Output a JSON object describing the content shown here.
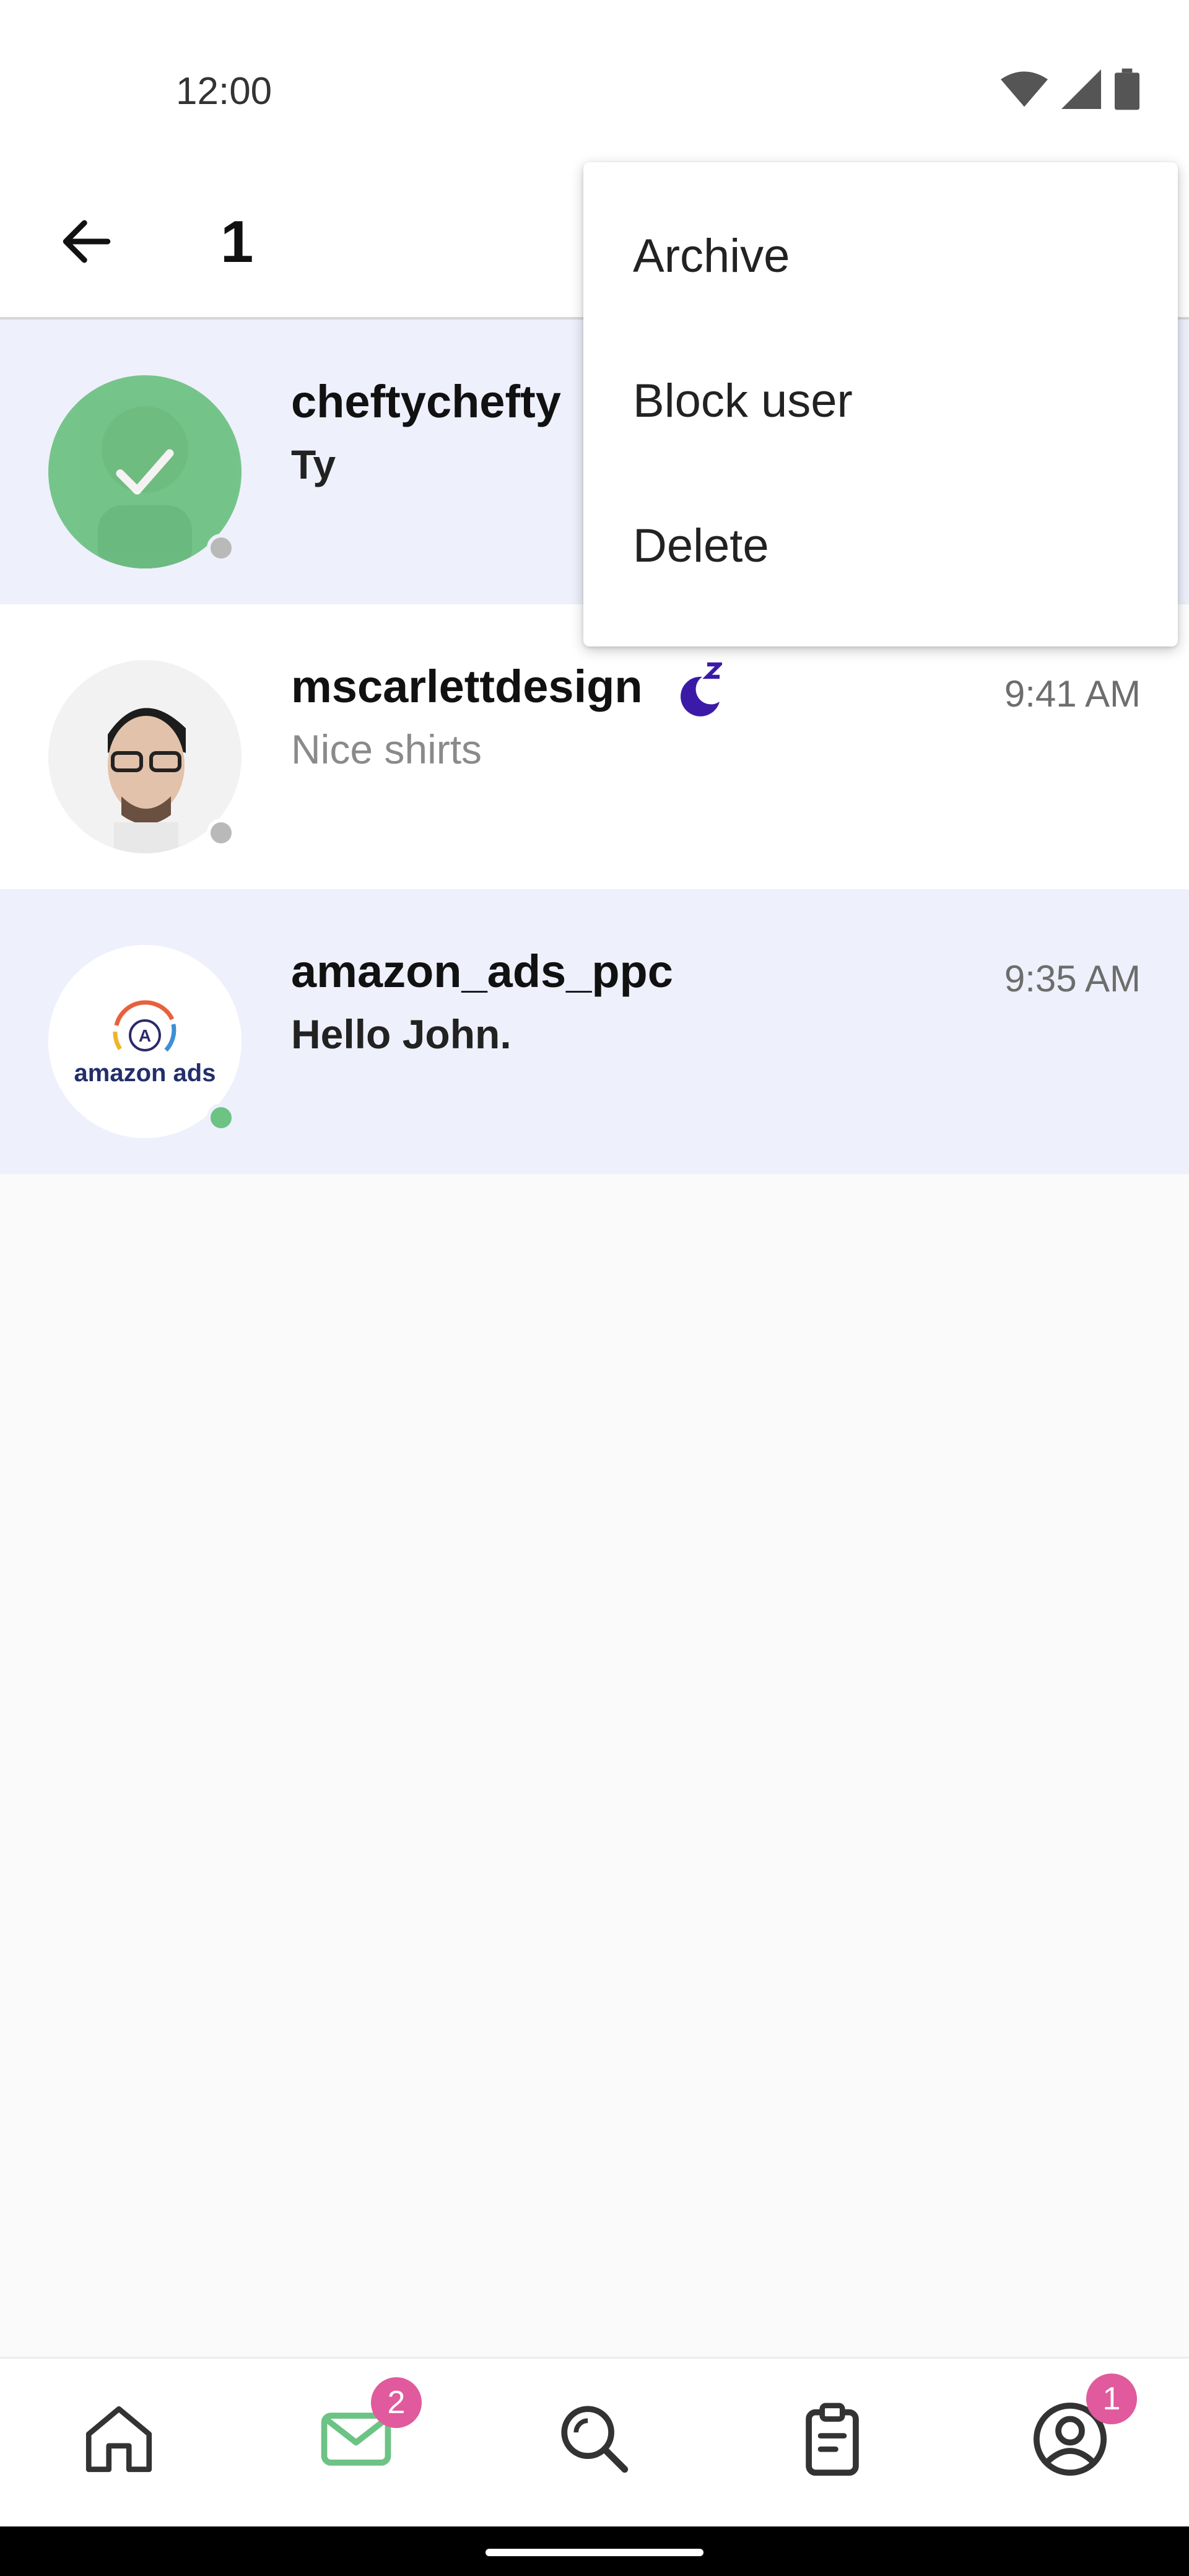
{
  "status_bar": {
    "time": "12:00",
    "icons": [
      "wifi-icon",
      "cell-signal-icon",
      "battery-icon"
    ]
  },
  "app_bar": {
    "back_icon": "arrow-left-icon",
    "selected_count": "1"
  },
  "menu": {
    "items": [
      "Archive",
      "Block user",
      "Delete"
    ]
  },
  "conversations": [
    {
      "name": "cheftychefty",
      "message": "Ty",
      "time": "",
      "state": "selected",
      "message_weight": "bold",
      "online": false
    },
    {
      "name": "mscarlettdesign",
      "message": "Nice shirts",
      "time": "9:41 AM",
      "state": "read",
      "message_weight": "light",
      "online": false,
      "away_icon": "moon-sleep-icon"
    },
    {
      "name": "amazon_ads_ppc",
      "message": "Hello John.",
      "time": "9:35 AM",
      "state": "unread",
      "message_weight": "bold",
      "online": true,
      "avatar_logo_text": "amazon ads"
    }
  ],
  "bottom_nav": {
    "items": [
      {
        "icon": "home-icon"
      },
      {
        "icon": "mail-icon",
        "badge": "2",
        "active": true
      },
      {
        "icon": "search-icon"
      },
      {
        "icon": "clipboard-icon"
      },
      {
        "icon": "profile-icon",
        "badge": "1"
      }
    ]
  },
  "colors": {
    "accent_green": "#6cc384",
    "badge_pink": "#e05a9d",
    "highlight": "#eef0fc",
    "away_purple": "#3b1aa8",
    "offline_gray": "#b9b9b9"
  }
}
